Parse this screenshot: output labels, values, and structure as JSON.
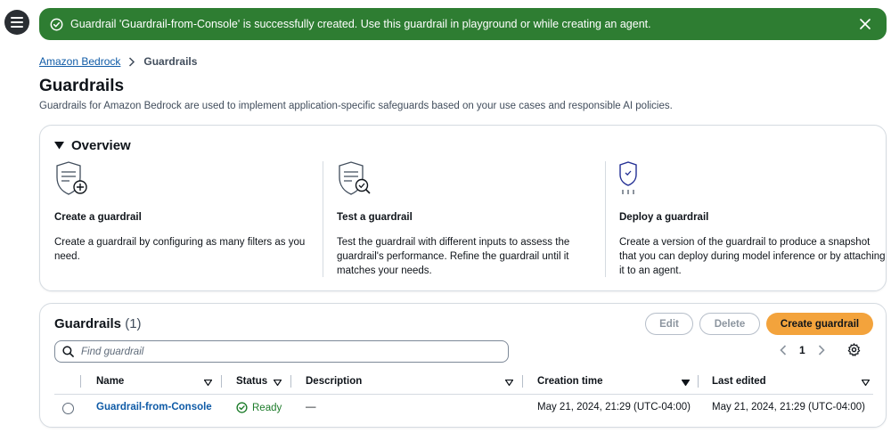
{
  "flash": {
    "message": "Guardrail 'Guardrail-from-Console' is successfully created. Use this guardrail in playground or while creating an agent.",
    "color": "#2e7d32"
  },
  "breadcrumb": {
    "parent": "Amazon Bedrock",
    "current": "Guardrails"
  },
  "page": {
    "title": "Guardrails",
    "description": "Guardrails for Amazon Bedrock are used to implement application-specific safeguards based on your use cases and responsible AI policies."
  },
  "overview": {
    "title": "Overview",
    "columns": [
      {
        "icon": "shield-plus-icon",
        "heading": "Create a guardrail",
        "text": "Create a guardrail by configuring as many filters as you need."
      },
      {
        "icon": "shield-search-icon",
        "heading": "Test a guardrail",
        "text": "Test the guardrail with different inputs to assess the guardrail's performance. Refine the guardrail until it matches your needs."
      },
      {
        "icon": "shield-deploy-icon",
        "heading": "Deploy a guardrail",
        "text": "Create a version of the guardrail to produce a snapshot that you can deploy during model inference or by attaching it to an agent."
      }
    ]
  },
  "table": {
    "title": "Guardrails",
    "count": "(1)",
    "buttons": {
      "edit": "Edit",
      "delete": "Delete",
      "create": "Create guardrail"
    },
    "search_placeholder": "Find guardrail",
    "page_number": "1",
    "columns": [
      "Name",
      "Status",
      "Description",
      "Creation time",
      "Last edited"
    ],
    "rows": [
      {
        "name": "Guardrail-from-Console",
        "status": "Ready",
        "description": "—",
        "creation_time": "May 21, 2024, 21:29 (UTC-04:00)",
        "last_edited": "May 21, 2024, 21:29 (UTC-04:00)"
      }
    ]
  },
  "colors": {
    "accent_link": "#0f5ba7",
    "primary_button": "#f3a33c",
    "success": "#1d7c2b"
  }
}
